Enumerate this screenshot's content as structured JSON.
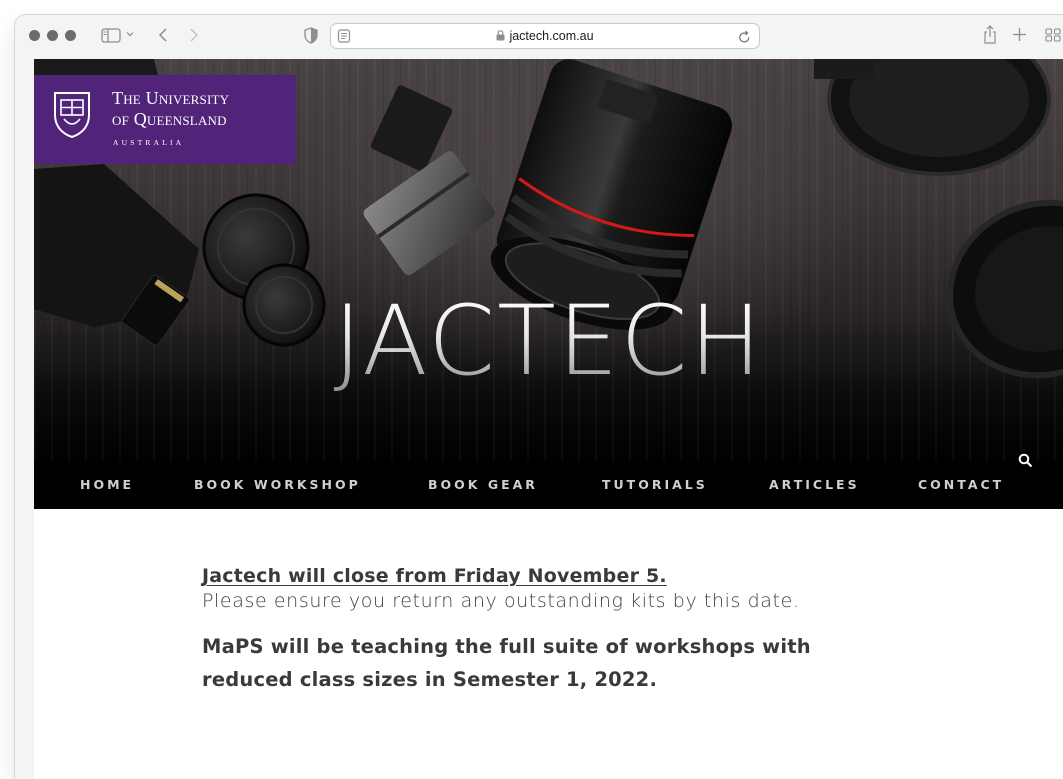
{
  "browser": {
    "url": "jactech.com.au",
    "icons": [
      "traffic-light-icon",
      "sidebar-icon",
      "chevron-down-icon",
      "back-icon",
      "forward-icon",
      "privacy-shield-icon",
      "reader-icon",
      "lock-icon",
      "reload-icon",
      "share-icon",
      "new-tab-icon",
      "tab-overview-icon"
    ]
  },
  "header": {
    "logo": {
      "line1": "The University",
      "line2": "of Queensland",
      "line3": "AUSTRALIA",
      "color": "#51247a"
    },
    "site_title": "JACTECH"
  },
  "nav": {
    "items": [
      {
        "label": "HOME"
      },
      {
        "label": "BOOK WORKSHOP"
      },
      {
        "label": "BOOK GEAR"
      },
      {
        "label": "TUTORIALS"
      },
      {
        "label": "ARTICLES"
      },
      {
        "label": "CONTACT"
      }
    ],
    "search_icon": "search-icon"
  },
  "content": {
    "closure_heading": "Jactech will close from Friday November 5.",
    "closure_text": "Please ensure you return any outstanding kits by this date.",
    "maps_notice": "MaPS will be teaching the full suite of workshops with reduced class sizes in Semester 1, 2022."
  }
}
